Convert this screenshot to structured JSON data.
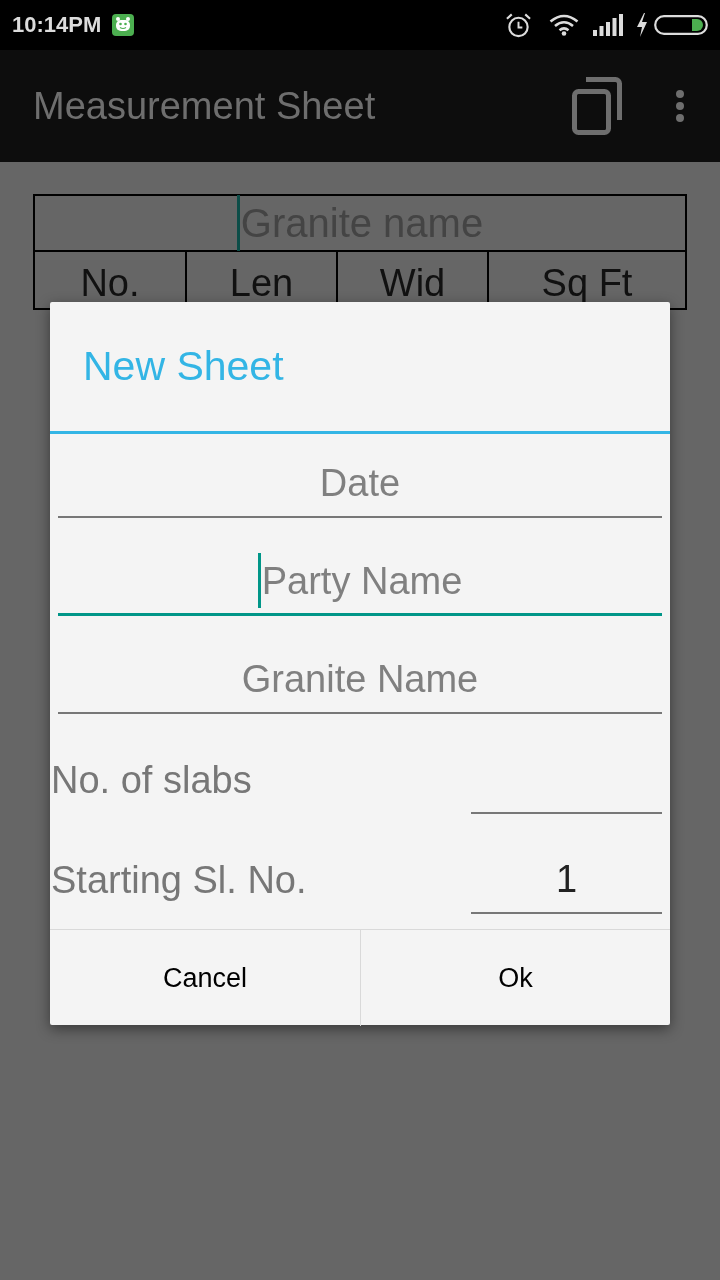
{
  "status_bar": {
    "time": "10:14PM"
  },
  "app_bar": {
    "title": "Measurement Sheet"
  },
  "sheet": {
    "name_field": {
      "placeholder": "Granite name",
      "focused": true
    },
    "columns": [
      "No.",
      "Len",
      "Wid",
      "Sq Ft"
    ]
  },
  "dialog": {
    "title": "New Sheet",
    "fields": [
      {
        "placeholder": "Date",
        "focused": false
      },
      {
        "placeholder": "Party Name",
        "focused": true
      },
      {
        "placeholder": "Granite Name",
        "focused": false
      }
    ],
    "rows": [
      {
        "label": "No. of slabs"
      },
      {
        "label": "Starting Sl. No.",
        "value": "1"
      }
    ],
    "buttons": [
      "Cancel",
      "Ok"
    ]
  }
}
